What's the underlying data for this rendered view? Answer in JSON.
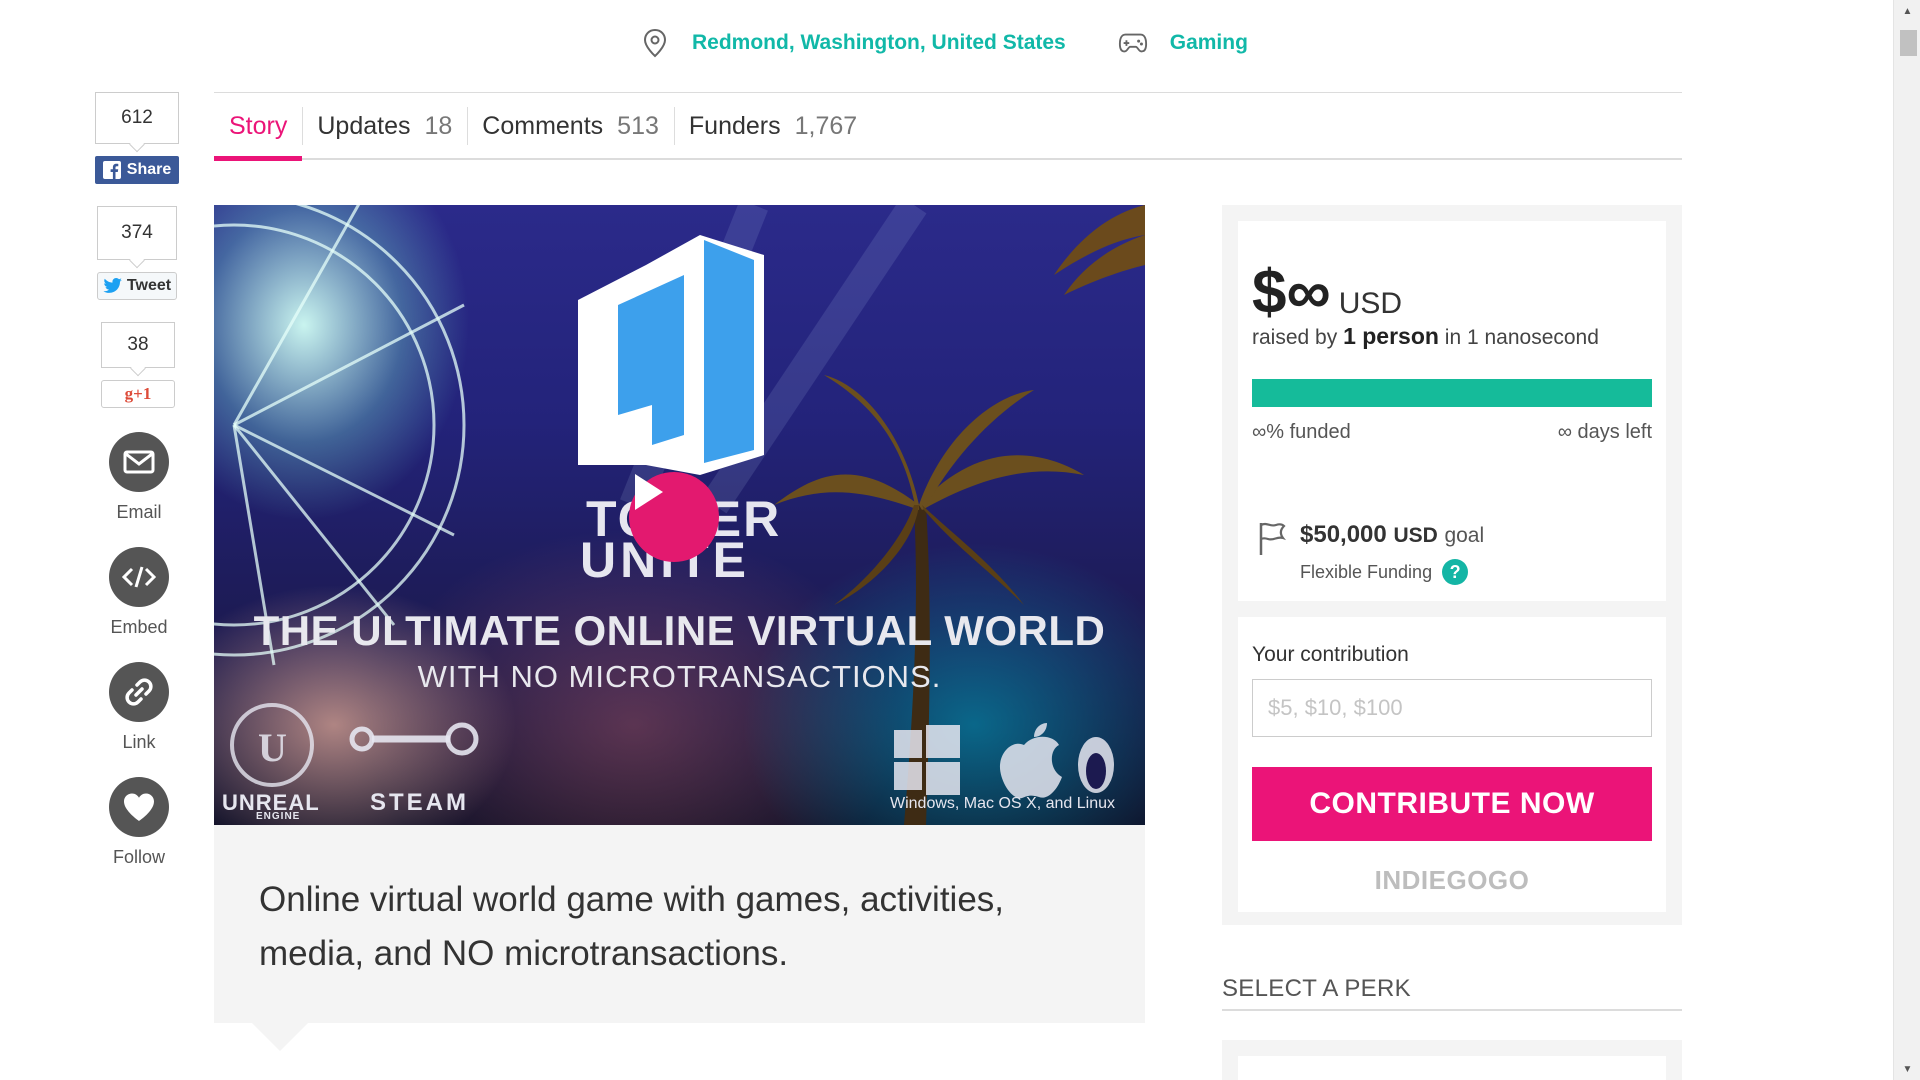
{
  "topbar": {
    "location": "Redmond, Washington, United States",
    "category": "Gaming",
    "location_icon": "map-pin-icon",
    "category_icon": "gamepad-icon"
  },
  "tabs": [
    {
      "label": "Story",
      "count": ""
    },
    {
      "label": "Updates",
      "count": "18"
    },
    {
      "label": "Comments",
      "count": "513"
    },
    {
      "label": "Funders",
      "count": "1,767"
    }
  ],
  "share": {
    "facebook_count": "612",
    "facebook_label": "Share",
    "twitter_count": "374",
    "twitter_label": "Tweet",
    "gplus_count": "38",
    "gplus_label": "g+1",
    "email_label": "Email",
    "embed_label": "Embed",
    "link_label": "Link",
    "follow_label": "Follow"
  },
  "video": {
    "logo_line1": "TOWER",
    "logo_line2": "UNITE",
    "headline": "THE ULTIMATE ONLINE VIRTUAL WORLD",
    "subline": "WITH NO MICROTRANSACTIONS.",
    "engine_label": "UNREAL",
    "engine_sub": "ENGINE",
    "steam_label": "STEAM",
    "platforms": "Windows, Mac OS X, and Linux"
  },
  "summary": "Online virtual world game with games, activities, media, and NO microtransactions.",
  "funding": {
    "amount": "$∞",
    "currency": "USD",
    "raised_prefix": "raised by",
    "raised_people": "1 person",
    "raised_suffix": "in 1 nanosecond",
    "progress_fraction": 1.0,
    "funded_text": "∞% funded",
    "days_text": "∞ days left",
    "goal_amount": "$50,000",
    "goal_unit": "USD",
    "goal_word": "goal",
    "funding_type": "Flexible Funding",
    "help_glyph": "?"
  },
  "contribution": {
    "label": "Your contribution",
    "placeholder": "$5, $10, $100",
    "button": "CONTRIBUTE NOW",
    "brand": "INDIEGOGO"
  },
  "perks": {
    "title": "SELECT A PERK"
  },
  "colors": {
    "accent_pink": "#eb1478",
    "accent_teal": "#11b8a8",
    "progress_green": "#15bb9a"
  }
}
